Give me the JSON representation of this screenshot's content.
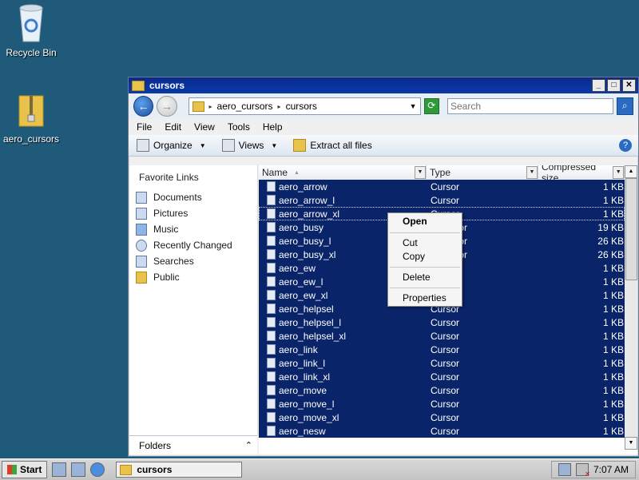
{
  "desktop": {
    "icons": [
      {
        "label": "Recycle Bin",
        "icon": "recycle-bin-icon"
      },
      {
        "label": "aero_cursors",
        "icon": "zip-folder-icon"
      }
    ]
  },
  "window": {
    "title": "cursors",
    "address": {
      "crumbs": [
        "aero_cursors",
        "cursors"
      ]
    },
    "search_placeholder": "Search",
    "menu": [
      "File",
      "Edit",
      "View",
      "Tools",
      "Help"
    ],
    "toolbar": {
      "organize": "Organize",
      "views": "Views",
      "extract": "Extract all files"
    },
    "favorites": {
      "title": "Favorite Links",
      "items": [
        "Documents",
        "Pictures",
        "Music",
        "Recently Changed",
        "Searches",
        "Public"
      ]
    },
    "folders_label": "Folders",
    "columns": {
      "name": "Name",
      "type": "Type",
      "size": "Compressed size"
    },
    "files": [
      {
        "name": "aero_arrow",
        "type": "Cursor",
        "size": "1 KB"
      },
      {
        "name": "aero_arrow_l",
        "type": "Cursor",
        "size": "1 KB"
      },
      {
        "name": "aero_arrow_xl",
        "type": "Cursor",
        "size": "1 KB"
      },
      {
        "name": "aero_busy",
        "type": "d Cursor",
        "size": "19 KB"
      },
      {
        "name": "aero_busy_l",
        "type": "d Cursor",
        "size": "26 KB"
      },
      {
        "name": "aero_busy_xl",
        "type": "d Cursor",
        "size": "26 KB"
      },
      {
        "name": "aero_ew",
        "type": "",
        "size": "1 KB"
      },
      {
        "name": "aero_ew_l",
        "type": "",
        "size": "1 KB"
      },
      {
        "name": "aero_ew_xl",
        "type": "",
        "size": "1 KB"
      },
      {
        "name": "aero_helpsel",
        "type": "Cursor",
        "size": "1 KB"
      },
      {
        "name": "aero_helpsel_l",
        "type": "Cursor",
        "size": "1 KB"
      },
      {
        "name": "aero_helpsel_xl",
        "type": "Cursor",
        "size": "1 KB"
      },
      {
        "name": "aero_link",
        "type": "Cursor",
        "size": "1 KB"
      },
      {
        "name": "aero_link_l",
        "type": "Cursor",
        "size": "1 KB"
      },
      {
        "name": "aero_link_xl",
        "type": "Cursor",
        "size": "1 KB"
      },
      {
        "name": "aero_move",
        "type": "Cursor",
        "size": "1 KB"
      },
      {
        "name": "aero_move_l",
        "type": "Cursor",
        "size": "1 KB"
      },
      {
        "name": "aero_move_xl",
        "type": "Cursor",
        "size": "1 KB"
      },
      {
        "name": "aero_nesw",
        "type": "Cursor",
        "size": "1 KB"
      }
    ]
  },
  "context_menu": {
    "open": "Open",
    "cut": "Cut",
    "copy": "Copy",
    "delete": "Delete",
    "properties": "Properties"
  },
  "taskbar": {
    "start": "Start",
    "task": "cursors",
    "clock": "7:07 AM"
  }
}
